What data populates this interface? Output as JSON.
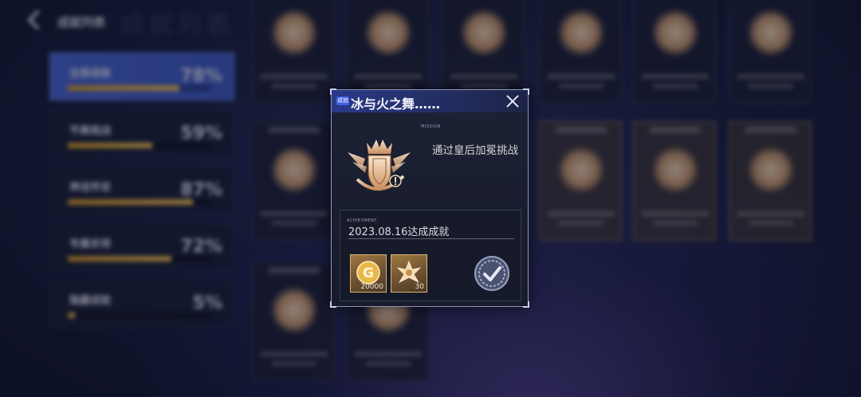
{
  "header": {
    "title": "成就列表",
    "ghost": "成就列表"
  },
  "sidebar": {
    "categories": [
      {
        "name": "全部成就",
        "percent": "78%",
        "progress": 0.78,
        "active": true
      },
      {
        "name": "节奏挑战",
        "percent": "59%",
        "progress": 0.59,
        "active": false
      },
      {
        "name": "神话传说",
        "percent": "87%",
        "progress": 0.87,
        "active": false
      },
      {
        "name": "专属安排",
        "percent": "72%",
        "progress": 0.72,
        "active": false
      },
      {
        "name": "隐藏成就",
        "percent": "5%",
        "progress": 0.05,
        "active": false
      }
    ]
  },
  "popup": {
    "badge": "成就",
    "title": "冰与火之舞……",
    "mission_label": "MISSION",
    "description": "通过皇后加冕挑战",
    "achievement_label": "ACHIEVMENT",
    "achieved_text": "2023.08.16达成成就",
    "rewards": [
      {
        "icon": "gold-coin-icon",
        "qty": "20000"
      },
      {
        "icon": "shard-material-icon",
        "qty": "30"
      }
    ],
    "completed_icon": "check-seal-icon"
  },
  "colors": {
    "accent": "#3f5bc8",
    "gold": "#e8b64a",
    "popup_bg": "#1a1f31"
  }
}
